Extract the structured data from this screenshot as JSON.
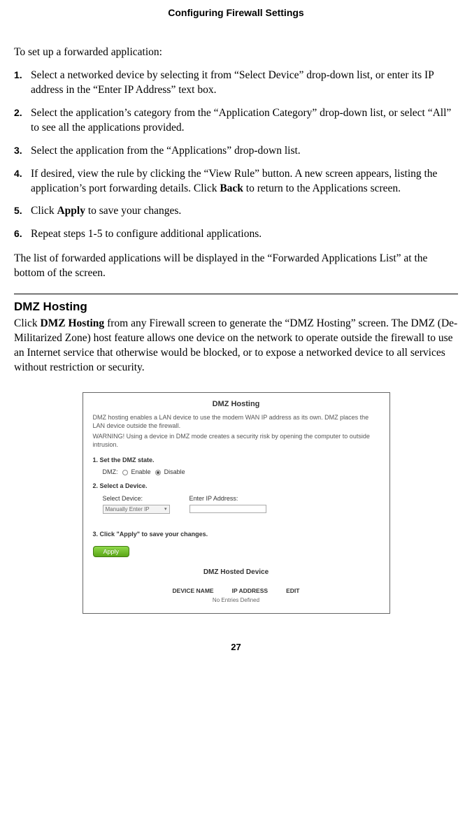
{
  "header": {
    "title": "Configuring Firewall Settings"
  },
  "intro": "To set up a forwarded application:",
  "steps": {
    "s1": "Select a networked device by selecting it from “Select Device” drop-down list, or enter its IP address in the “Enter IP Address” text box.",
    "s2": "Select the application’s category from the “Application Category” drop-down list, or select “All” to see all the applications provided.",
    "s3": "Select the application from the “Applications” drop-down list.",
    "s4_a": "If desired, view the rule by clicking the “View Rule” button. A new screen appears, listing the application’s port forwarding details. Click ",
    "s4_bold": "Back",
    "s4_b": " to return to the Applications screen.",
    "s5_a": "Click ",
    "s5_bold": "Apply",
    "s5_b": " to save your changes.",
    "s6": "Repeat steps 1-5 to configure additional applications."
  },
  "paragraph_after_steps": "The list of forwarded applications will be displayed in the “Forwarded Applications List” at the bottom of the screen.",
  "section": {
    "heading": "DMZ Hosting",
    "body_a": "Click ",
    "body_bold": "DMZ Hosting",
    "body_b": " from any Firewall screen to generate the “DMZ Hosting” screen. The DMZ (De-Militarized Zone) host feature allows one device on the network to operate outside the firewall to use an Internet service that otherwise would be blocked, or to expose a networked device to all services without restriction or security."
  },
  "panel": {
    "title": "DMZ Hosting",
    "desc": "DMZ hosting enables a LAN device to use the modem WAN IP address as its own. DMZ places the LAN device outside the firewall.",
    "warning": "WARNING! Using a device in DMZ mode creates a security risk by opening the computer to outside intrusion.",
    "step1": "1. Set the DMZ state.",
    "dmz_label": "DMZ:",
    "enable": "Enable",
    "disable": "Disable",
    "step2": "2. Select a Device.",
    "select_device_label": "Select Device:",
    "enter_ip_label": "Enter IP Address:",
    "select_device_value": "Manually Enter IP",
    "step3": "3. Click \"Apply\" to save your changes.",
    "apply": "Apply",
    "hosted_title": "DMZ Hosted Device",
    "col1": "DEVICE NAME",
    "col2": "IP  ADDRESS",
    "col3": "EDIT",
    "no_entries": "No Entries Defined"
  },
  "page_number": "27"
}
